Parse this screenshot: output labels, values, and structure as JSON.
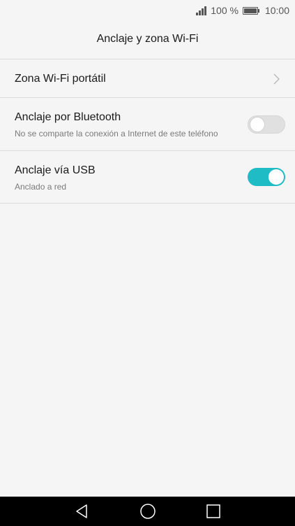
{
  "status_bar": {
    "signal_icon": "signal-icon",
    "battery_text": "100 %",
    "battery_icon": "battery-icon",
    "time": "10:00"
  },
  "header": {
    "title": "Anclaje y zona Wi-Fi"
  },
  "items": [
    {
      "title": "Zona Wi-Fi portátil",
      "control": "chevron-right-icon"
    },
    {
      "title": "Anclaje por Bluetooth",
      "subtitle": "No se comparte la conexión a Internet de este teléfono",
      "control": "toggle",
      "enabled": false
    },
    {
      "title": "Anclaje vía USB",
      "subtitle": "Anclado a red",
      "control": "toggle",
      "enabled": true
    }
  ],
  "colors": {
    "accent": "#1fbcc6",
    "background": "#f5f5f5",
    "nav_bar": "#000000"
  },
  "nav_bar": {
    "back_icon": "back-triangle-icon",
    "home_icon": "home-circle-icon",
    "recents_icon": "recents-square-icon"
  }
}
